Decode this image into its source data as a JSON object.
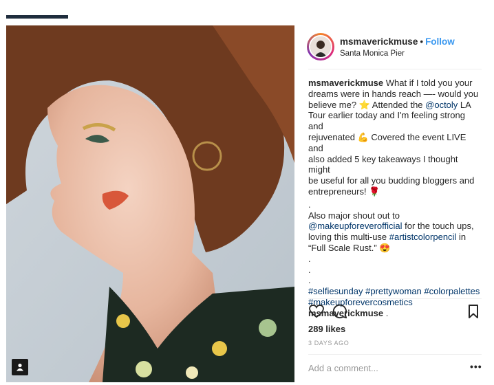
{
  "post": {
    "username": "msmaverickmuse",
    "separator": "•",
    "follow_label": "Follow",
    "location": "Santa Monica Pier",
    "caption_lines": [
      [
        "What if I told you your"
      ],
      [
        "dreams were in hands reach —- would you"
      ],
      [
        "believe me? ⭐  Attended the ",
        "@octoly",
        " LA"
      ],
      [
        "Tour earlier today and I'm feeling strong and"
      ],
      [
        "rejuvenated 💪  Covered the event LIVE and"
      ],
      [
        "also added 5 key takeaways I thought might"
      ],
      [
        "be useful for all you budding bloggers and"
      ],
      [
        "entrepreneurs! 🌹"
      ]
    ],
    "caption_text": {
      "l1": "What if I told you your",
      "l2": "dreams were in hands reach —- would you",
      "l3a": "believe me? ",
      "l3b": " Attended the ",
      "mention_octoly": "@octoly",
      "l3c": " LA",
      "l4": "Tour earlier today and I'm feeling strong and",
      "l5a": "rejuvenated ",
      "l5b": " Covered the event LIVE and",
      "l6": "also added 5 key takeaways I thought might",
      "l7": "be useful for all you budding bloggers and",
      "l8": "entrepreneurs! ",
      "dot": ".",
      "shout": "Also major shout out to",
      "mention_mufe": "@makeupforeverofficial",
      "touch": " for the touch ups,",
      "loving": "loving this multi-use ",
      "tag_artist": "#artistcolorpencil",
      "in": " in",
      "rust": "“Full Scale Rust.” ",
      "tag_selfie": "#selfiesunday",
      "tag_pretty": "#prettywoman",
      "tag_palettes": "#colorpalettes",
      "tag_mufec": "#makeupforevercosmetics"
    },
    "comment": {
      "username": "msmaverickmuse",
      "text": "."
    },
    "trailing_dot": ".",
    "likes": "289 likes",
    "time": "3 DAYS AGO",
    "add_comment_placeholder": "Add a comment...",
    "more_label": "•••"
  },
  "colors": {
    "link": "#003569",
    "follow": "#3897f0",
    "muted": "#999999",
    "divider": "#efefef"
  },
  "icons": [
    "heart-icon",
    "comment-icon",
    "bookmark-icon",
    "tagged-user-icon"
  ]
}
